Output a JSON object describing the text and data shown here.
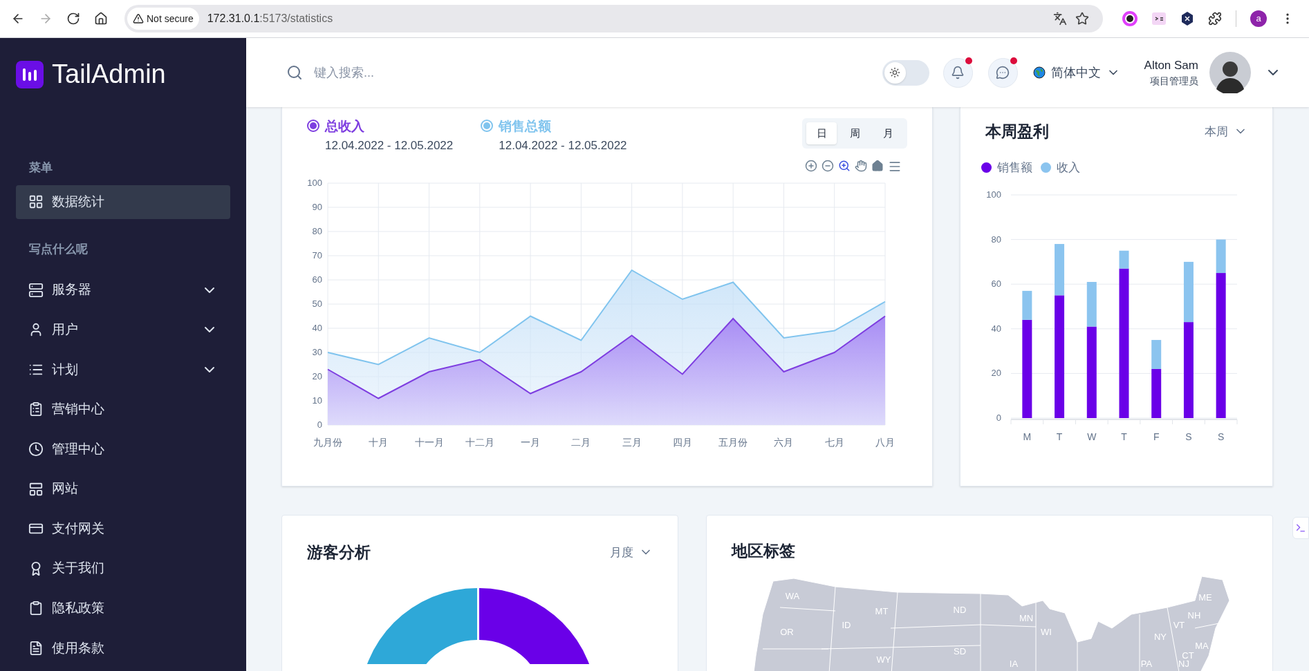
{
  "browser": {
    "security": "Not secure",
    "url_host": "172.31.0.1",
    "url_path": ":5173/statistics",
    "profile": "a"
  },
  "sidebar": {
    "logo": "TailAdmin",
    "sections": [
      {
        "title": "菜单",
        "items": [
          {
            "label": "数据统计",
            "selected": true,
            "submenu": false
          }
        ]
      },
      {
        "title": "写点什么呢",
        "items": [
          {
            "label": "服务器",
            "selected": false,
            "submenu": true
          },
          {
            "label": "用户",
            "selected": false,
            "submenu": true
          },
          {
            "label": "计划",
            "selected": false,
            "submenu": true
          },
          {
            "label": "营销中心",
            "selected": false,
            "submenu": false
          },
          {
            "label": "管理中心",
            "selected": false,
            "submenu": false
          },
          {
            "label": "网站",
            "selected": false,
            "submenu": false
          },
          {
            "label": "支付网关",
            "selected": false,
            "submenu": false
          },
          {
            "label": "关于我们",
            "selected": false,
            "submenu": false
          },
          {
            "label": "隐私政策",
            "selected": false,
            "submenu": false
          },
          {
            "label": "使用条款",
            "selected": false,
            "submenu": false
          }
        ]
      }
    ]
  },
  "header": {
    "search": {
      "placeholder": "键入搜索..."
    },
    "dark_mode": false,
    "notifications_unread": true,
    "messages_unread": true,
    "language": "简体中文",
    "user": {
      "name": "Alton Sam",
      "role": "项目管理员"
    }
  },
  "revenue_card": {
    "legend": [
      {
        "dates": "12.04.2022 - 12.05.2022"
      },
      {
        "dates": "12.04.2022 - 12.05.2022"
      }
    ],
    "tabs": [
      {
        "label": "日",
        "selected": true
      },
      {
        "label": "周",
        "selected": false
      },
      {
        "label": "月",
        "selected": false
      }
    ],
    "chart_data": {
      "type": "area",
      "categories": [
        "九月份",
        "十月",
        "十一月",
        "十二月",
        "一月",
        "二月",
        "三月",
        "四月",
        "五月份",
        "六月",
        "七月",
        "八月"
      ],
      "series": [
        {
          "name": "总收入",
          "color": "#7e3ee0",
          "values": [
            23,
            11,
            22,
            27,
            13,
            22,
            37,
            21,
            44,
            22,
            30,
            45
          ]
        },
        {
          "name": "销售总额",
          "color": "#80c4ee",
          "values": [
            30,
            25,
            36,
            30,
            45,
            35,
            64,
            52,
            59,
            36,
            39,
            51
          ]
        }
      ],
      "ylim": [
        0,
        100
      ],
      "yticks": [
        0,
        10,
        20,
        30,
        40,
        50,
        60,
        70,
        80,
        90,
        100
      ],
      "grid": true
    }
  },
  "profit_card": {
    "title": "本周盈利",
    "period": "本周",
    "chart_data": {
      "type": "bar",
      "stacked": true,
      "categories": [
        "M",
        "T",
        "W",
        "T",
        "F",
        "S",
        "S"
      ],
      "series": [
        {
          "name": "销售额",
          "color": "#6a00e8",
          "values": [
            44,
            55,
            41,
            67,
            22,
            43,
            65
          ]
        },
        {
          "name": "收入",
          "color": "#8bc4ef",
          "values": [
            13,
            23,
            20,
            8,
            13,
            27,
            15
          ]
        }
      ],
      "ylim": [
        0,
        100
      ],
      "yticks": [
        0,
        20,
        40,
        60,
        80,
        100
      ],
      "grid": true
    }
  },
  "visitors_card": {
    "title": "游客分析",
    "period": "月度"
  },
  "region_card": {
    "title": "地区标签",
    "map_labels": [
      "WA",
      "MT",
      "ND",
      "MN",
      "ME",
      "VT",
      "NH",
      "OR",
      "ID",
      "WI",
      "NY",
      "MA",
      "CT",
      "WY",
      "SD",
      "IA",
      "PA",
      "NJ"
    ]
  }
}
